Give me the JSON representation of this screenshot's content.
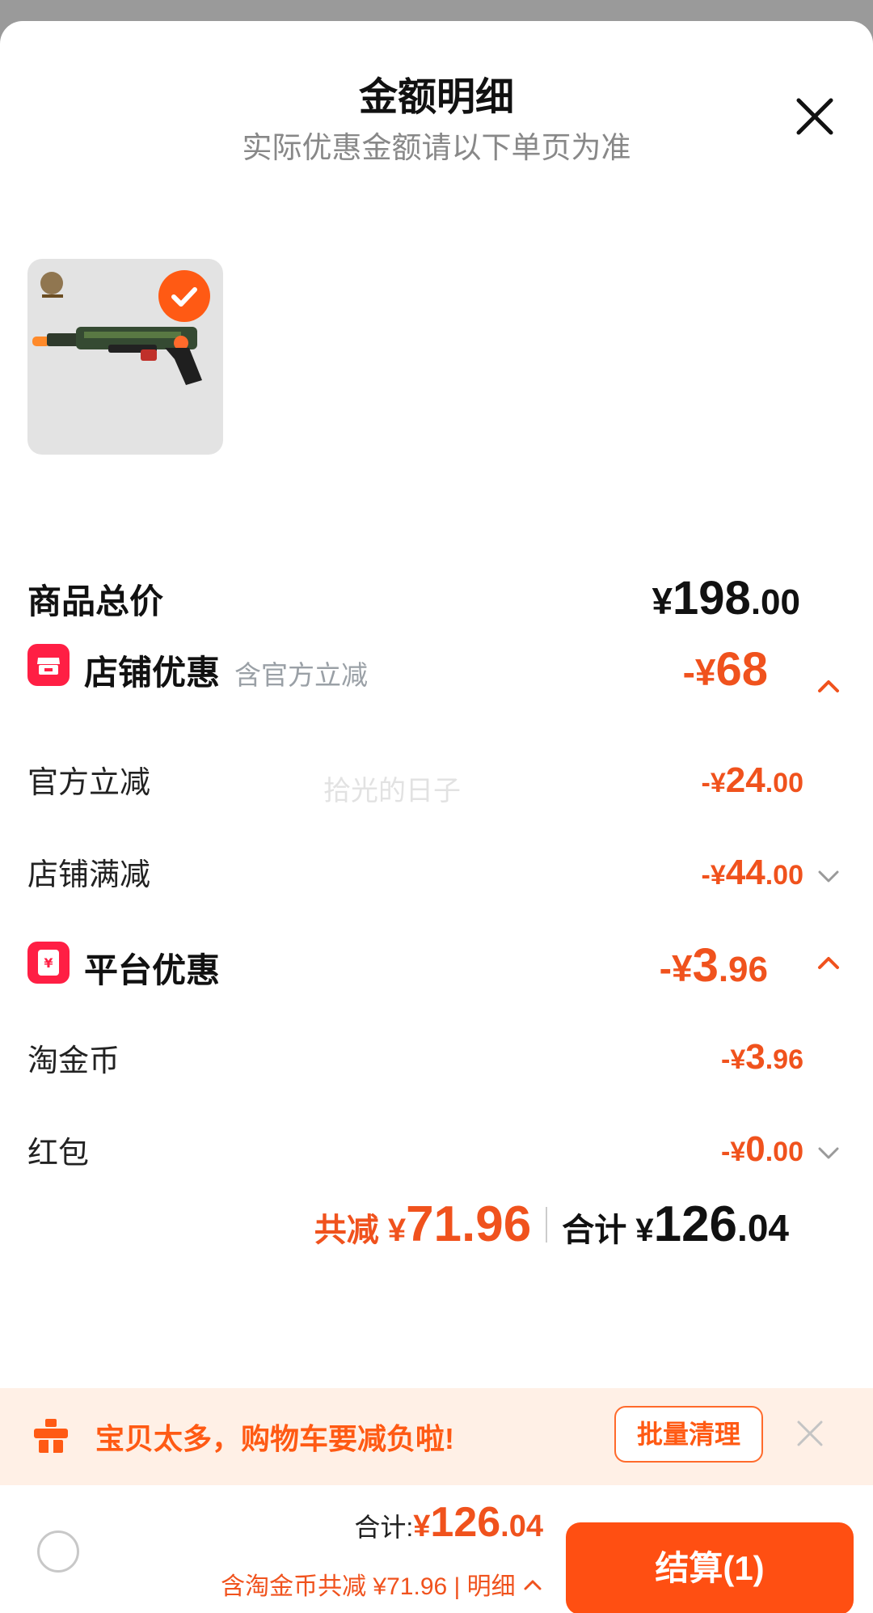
{
  "header": {
    "title": "金额明细",
    "subtitle": "实际优惠金额请以下单页为准",
    "close_icon": "close-icon"
  },
  "product": {
    "image": "toy-gun-product-image",
    "selected": true
  },
  "price": {
    "label": "商品总价",
    "currency": "¥",
    "int": "198",
    "dec": ".00"
  },
  "store_discount": {
    "icon": "store-icon",
    "label": "店铺优惠",
    "note": "含官方立减",
    "amount_prefix": "-¥",
    "amount_int": "68",
    "amount_dec": "",
    "items": [
      {
        "label": "官方立减",
        "prefix": "-¥",
        "int": "24",
        "dec": ".00",
        "expandable": false
      },
      {
        "label": "店铺满减",
        "prefix": "-¥",
        "int": "44",
        "dec": ".00",
        "expandable": true
      }
    ]
  },
  "platform_discount": {
    "icon": "red-packet-icon",
    "label": "平台优惠",
    "amount_prefix": "-¥",
    "amount_int": "3",
    "amount_dec": ".96",
    "items": [
      {
        "label": "淘金币",
        "prefix": "-¥",
        "int": "3",
        "dec": ".96",
        "expandable": false
      },
      {
        "label": "红包",
        "prefix": "-¥",
        "int": "0",
        "dec": ".00",
        "expandable": true
      }
    ]
  },
  "summary": {
    "saved_label": "共减 ¥",
    "saved_value": "71.96",
    "total_label": "合计 ¥",
    "total_int": "126",
    "total_dec": ".04"
  },
  "watermark": "拾光的日子",
  "banner": {
    "icon": "shopping-cart-overload-icon",
    "text": "宝贝太多，购物车要减负啦!",
    "button": "批量清理"
  },
  "footer": {
    "total_label": "合计:",
    "currency": "¥",
    "total_int": "126",
    "total_dec": ".04",
    "sub_text": "含淘金币共减 ¥71.96 | 明细",
    "pay_button": "结算(1)"
  },
  "colors": {
    "accent": "#f0521d",
    "button": "#ff4f12",
    "badge": "#ff1f44",
    "banner_bg": "#fff0e6"
  }
}
